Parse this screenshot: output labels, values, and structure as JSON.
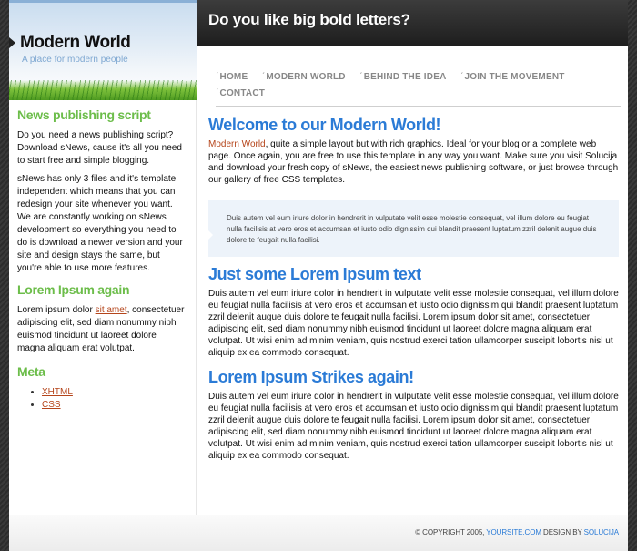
{
  "brand": {
    "title": "Modern World",
    "tagline": "A place for modern people"
  },
  "header": {
    "title": "Do you like big bold letters?"
  },
  "nav": {
    "items": [
      {
        "label": "HOME"
      },
      {
        "label": "MODERN WORLD"
      },
      {
        "label": "BEHIND THE IDEA"
      },
      {
        "label": "JOIN THE MOVEMENT"
      },
      {
        "label": "CONTACT"
      }
    ]
  },
  "sidebar": {
    "section1": {
      "heading": "News publishing script",
      "p1": "Do you need a news publishing script? Download sNews, cause it's all you need to start free and simple blogging.",
      "p2": "sNews has only 3 files and it's template independent which means that you can redesign your site whenever you want. We are constantly working on sNews development so everything you need to do is download a newer version and your site and design stays the same, but you're able to use more features."
    },
    "section2": {
      "heading": "Lorem Ipsum again",
      "before_link": "Lorem ipsum dolor ",
      "link": "sit amet",
      "after_link": ", consectetuer adipiscing elit, sed diam nonummy nibh euismod tincidunt ut laoreet dolore magna aliquam erat volutpat."
    },
    "meta": {
      "heading": "Meta",
      "links": [
        "XHTML",
        "CSS"
      ]
    }
  },
  "main": {
    "welcome": {
      "heading": "Welcome to our Modern World!",
      "link": "Modern World",
      "text": ", quite a simple layout but with rich graphics. Ideal for your blog or a complete web page. Once again, you are free to use this template in any way you want. Make sure you visit Solucija and download your fresh copy of sNews, the easiest news publishing software, or just browse through our gallery of free CSS templates."
    },
    "quote": "Duis autem vel eum iriure dolor in hendrerit in vulputate velit esse molestie consequat, vel illum dolore eu feugiat nulla facilisis at vero eros et accumsan et iusto odio dignissim qui blandit praesent luptatum zzril delenit augue duis dolore te feugait nulla facilisi.",
    "section2": {
      "heading": "Just some Lorem Ipsum text",
      "text": "Duis autem vel eum iriure dolor in hendrerit in vulputate velit esse molestie consequat, vel illum dolore eu feugiat nulla facilisis at vero eros et accumsan et iusto odio dignissim qui blandit praesent luptatum zzril delenit augue duis dolore te feugait nulla facilisi. Lorem ipsum dolor sit amet, consectetuer adipiscing elit, sed diam nonummy nibh euismod tincidunt ut laoreet dolore magna aliquam erat volutpat. Ut wisi enim ad minim veniam, quis nostrud exerci tation ullamcorper suscipit lobortis nisl ut aliquip ex ea commodo consequat."
    },
    "section3": {
      "heading": "Lorem Ipsum Strikes again!",
      "text": "Duis autem vel eum iriure dolor in hendrerit in vulputate velit esse molestie consequat, vel illum dolore eu feugiat nulla facilisis at vero eros et accumsan et iusto odio dignissim qui blandit praesent luptatum zzril delenit augue duis dolore te feugait nulla facilisi. Lorem ipsum dolor sit amet, consectetuer adipiscing elit, sed diam nonummy nibh euismod tincidunt ut laoreet dolore magna aliquam erat volutpat. Ut wisi enim ad minim veniam, quis nostrud exerci tation ullamcorper suscipit lobortis nisl ut aliquip ex ea commodo consequat."
    }
  },
  "footer": {
    "copyright": "© COPYRIGHT 2005, ",
    "site_link": "YOURSITE.COM",
    "design_by": " DESIGN BY ",
    "designer_link": "SOLUCIJA"
  }
}
